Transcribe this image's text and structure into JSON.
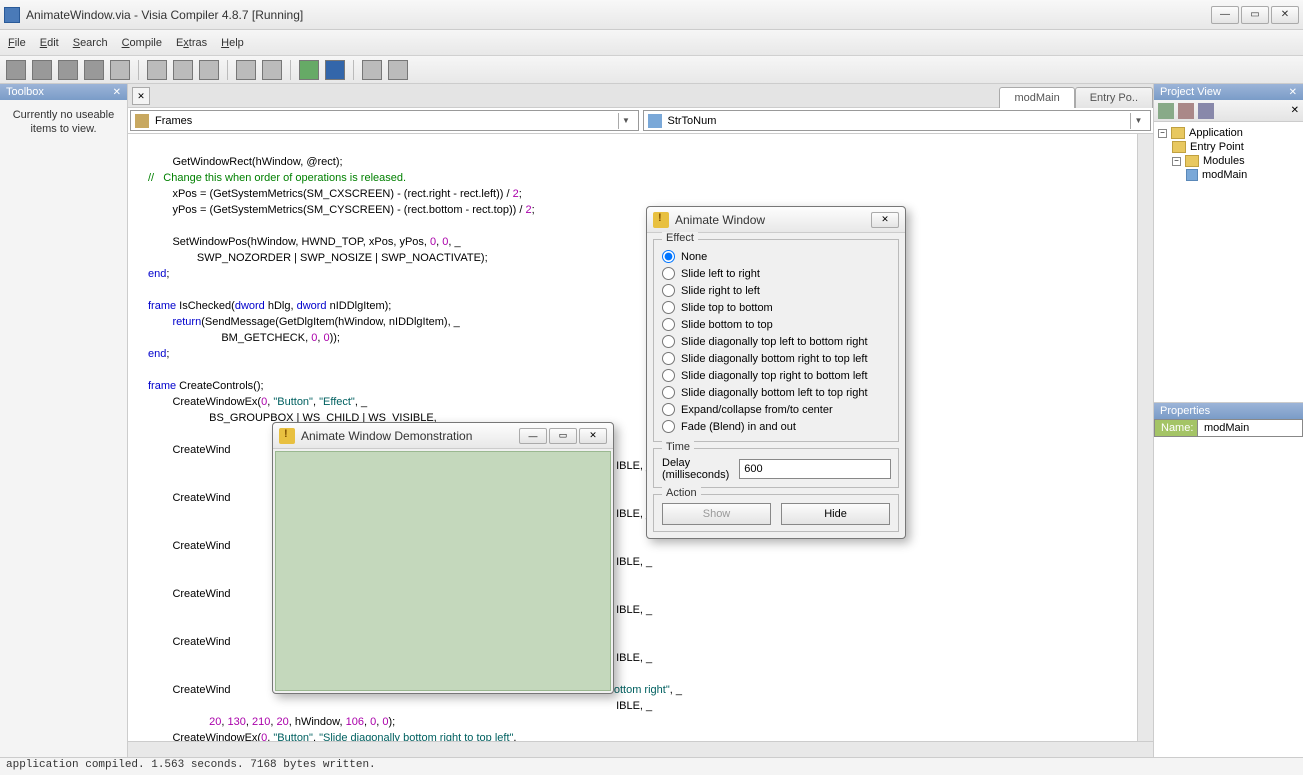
{
  "window": {
    "title": "AnimateWindow.via - Visia Compiler 4.8.7 [Running]"
  },
  "menus": [
    "File",
    "Edit",
    "Search",
    "Compile",
    "Extras",
    "Help"
  ],
  "toolbox": {
    "header": "Toolbox",
    "message": "Currently no useable items to view."
  },
  "tabs": {
    "modMain": "modMain",
    "entry": "Entry Po.."
  },
  "combos": {
    "left": "Frames",
    "right": "StrToNum"
  },
  "projview": {
    "header": "Project View",
    "nodes": {
      "app": "Application",
      "entry": "Entry Point",
      "modules": "Modules",
      "modMain": "modMain"
    }
  },
  "properties": {
    "header": "Properties",
    "nameKey": "Name:",
    "nameVal": "modMain"
  },
  "status": "application compiled. 1.563 seconds. 7168 bytes written.",
  "code": {
    "l1": "        GetWindowRect(hWindow, @rect);",
    "l2": "//   Change this when order of operations is released.",
    "l3a": "        xPos = (GetSystemMetrics(SM_CXSCREEN) - (rect.right - rect.left)) / ",
    "l3b": "2",
    "l3c": ";",
    "l4a": "        yPos = (GetSystemMetrics(SM_CYSCREEN) - (rect.bottom - rect.top)) / ",
    "l4b": "2",
    "l4c": ";",
    "l5": "",
    "l6a": "        SetWindowPos(hWindow, HWND_TOP, xPos, yPos, ",
    "l6b": "0",
    "l6c": ", ",
    "l6d": "0",
    "l6e": ", _",
    "l7": "                SWP_NOZORDER | SWP_NOSIZE | SWP_NOACTIVATE);",
    "l8": "end",
    "l8b": ";",
    "l9": "",
    "l10a": "frame",
    "l10b": " IsChecked(",
    "l10c": "dword",
    "l10d": " hDlg, ",
    "l10e": "dword",
    "l10f": " nIDDlgItem);",
    "l11a": "        ",
    "l11b": "return",
    "l11c": "(SendMessage(GetDlgItem(hWindow, nIDDlgItem), _",
    "l12a": "                        BM_GETCHECK, ",
    "l12n1": "0",
    "l12c": ", ",
    "l12n2": "0",
    "l12e": "));",
    "l13": "end",
    "l13b": ";",
    "l14": "",
    "l15a": "frame",
    "l15b": " CreateControls();",
    "l16a": "        CreateWindowEx(",
    "l16n": "0",
    "l16b": ", ",
    "l16s1": "\"Button\"",
    "l16c": ", ",
    "l16s2": "\"Effect\"",
    "l16d": ", _",
    "l17": "                    BS_GROUPBOX | WS_CHILD | WS_VISIBLE, _",
    "l18": "        CreateWind",
    "l19": "IBLE, _",
    "l20": "        CreateWind",
    "l21": "IBLE, _",
    "l22": "        CreateWind",
    "l23": "IBLE, _",
    "l24": "        CreateWind",
    "l25": "IBLE, _",
    "l26": "        CreateWind",
    "l27": "IBLE, _",
    "l28": "        CreateWind",
    "l29a": "t to bottom right\"",
    "l29b": ", _",
    "l30": "IBLE, _",
    "l31a": "                    ",
    "l31n1": "20",
    "l31c1": ", ",
    "l31n2": "130",
    "l31c2": ", ",
    "l31n3": "210",
    "l31c3": ", ",
    "l31n4": "20",
    "l31c4": ", hWindow, ",
    "l31n5": "106",
    "l31c5": ", ",
    "l31n6": "0",
    "l31c6": ", ",
    "l31n7": "0",
    "l31c7": ");",
    "l32a": "        CreateWindowEx(",
    "l32n": "0",
    "l32b": ", ",
    "l32s1": "\"Button\"",
    "l32c": ", ",
    "l32s2": "\"Slide diagonally bottom right to top left\"",
    "l32d": ","
  },
  "demo": {
    "title": "Animate Window Demonstration"
  },
  "anim": {
    "title": "Animate Window",
    "effect": "Effect",
    "opts": {
      "none": "None",
      "slr": "Slide left to right",
      "srl": "Slide right to left",
      "stb": "Slide top to bottom",
      "sbt": "Slide bottom to top",
      "sdtlbr": "Slide diagonally top left to bottom right",
      "sdbrtl": "Slide diagonally bottom right to top left",
      "sdtrbl": "Slide diagonally top right to bottom left",
      "sdbltr": "Slide diagonally bottom left to top right",
      "expand": "Expand/collapse from/to center",
      "fade": "Fade (Blend) in and out"
    },
    "time": "Time",
    "delayLabel": "Delay (milliseconds)",
    "delayValue": "600",
    "action": "Action",
    "show": "Show",
    "hide": "Hide"
  }
}
